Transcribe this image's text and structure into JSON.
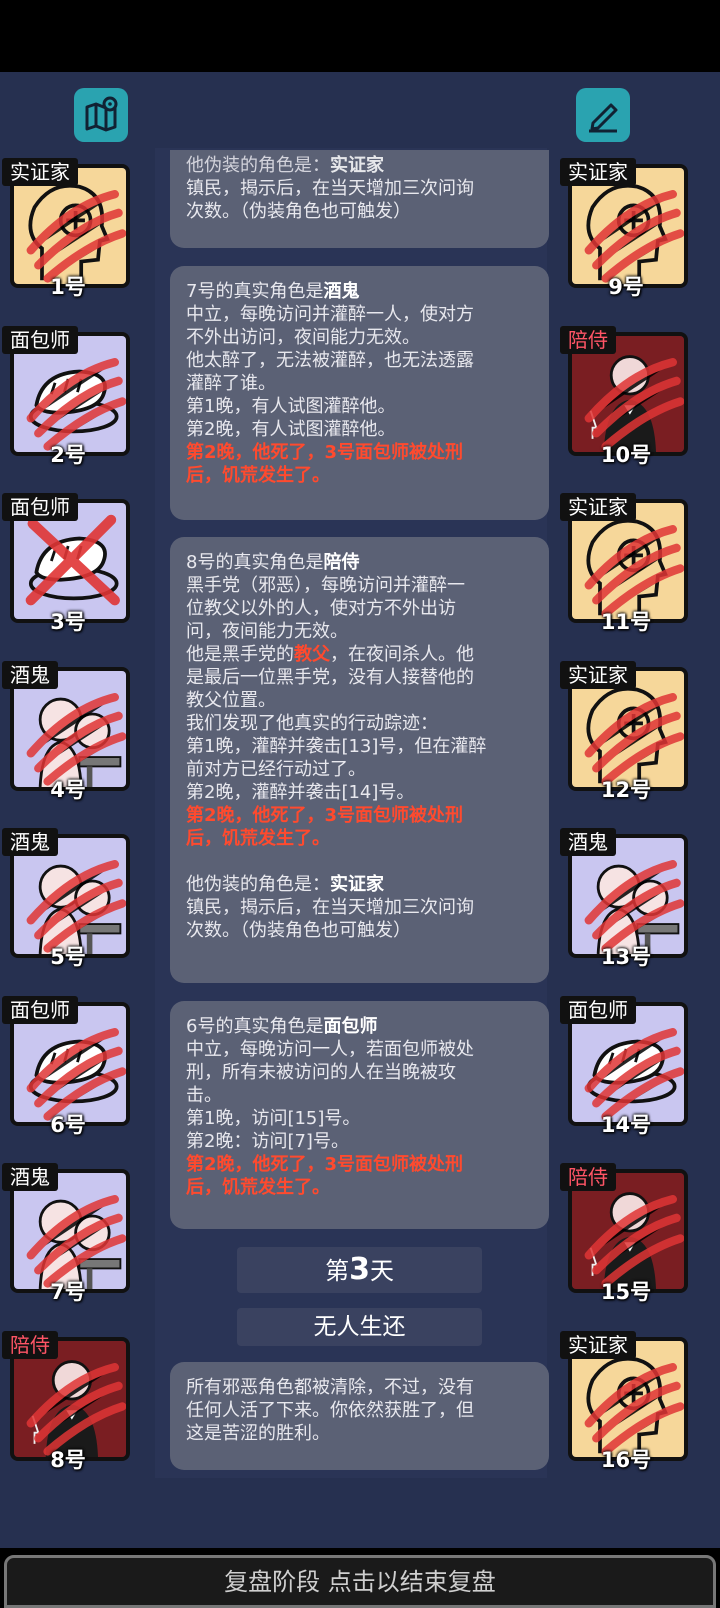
{
  "header": {
    "map_icon": "map-icon",
    "notes_icon": "pen-icon"
  },
  "left_players": [
    {
      "role": "实证家",
      "num": "1号",
      "kind": "empiricist"
    },
    {
      "role": "面包师",
      "num": "2号",
      "kind": "baker"
    },
    {
      "role": "面包师",
      "num": "3号",
      "kind": "baker-x"
    },
    {
      "role": "酒鬼",
      "num": "4号",
      "kind": "drunk"
    },
    {
      "role": "酒鬼",
      "num": "5号",
      "kind": "drunk"
    },
    {
      "role": "面包师",
      "num": "6号",
      "kind": "baker"
    },
    {
      "role": "酒鬼",
      "num": "7号",
      "kind": "drunk"
    },
    {
      "role": "陪侍",
      "num": "8号",
      "kind": "escort"
    }
  ],
  "right_players": [
    {
      "role": "实证家",
      "num": "9号",
      "kind": "empiricist"
    },
    {
      "role": "陪侍",
      "num": "10号",
      "kind": "escort"
    },
    {
      "role": "实证家",
      "num": "11号",
      "kind": "empiricist"
    },
    {
      "role": "实证家",
      "num": "12号",
      "kind": "empiricist"
    },
    {
      "role": "酒鬼",
      "num": "13号",
      "kind": "drunk"
    },
    {
      "role": "面包师",
      "num": "14号",
      "kind": "baker"
    },
    {
      "role": "陪侍",
      "num": "15号",
      "kind": "escort"
    },
    {
      "role": "实证家",
      "num": "16号",
      "kind": "empiricist"
    }
  ],
  "log": {
    "m0": {
      "line1_a": "他伪装的角色是：",
      "line1_b": "实证家",
      "line2": "镇民，揭示后，在当天增加三次问询",
      "line3": "次数。（伪装角色也可触发）"
    },
    "m1": {
      "title_a": "7号的真实角色是",
      "title_b": "酒鬼",
      "l1": "中立，每晚访问并灌醉一人，使对方",
      "l2": "不外出访问，夜间能力无效。",
      "l3": "他太醉了，无法被灌醉，也无法透露",
      "l4": "灌醉了谁。",
      "l5": "第1晚，有人试图灌醉他。",
      "l6": "第2晚，有人试图灌醉他。",
      "r1": "第2晚，他死了，3号面包师被处刑",
      "r2": "后，饥荒发生了。"
    },
    "m2": {
      "title_a": "8号的真实角色是",
      "title_b": "陪侍",
      "l1": "黑手党（邪恶），每晚访问并灌醉一",
      "l2": "位教父以外的人，使对方不外出访",
      "l3": "问，夜间能力无效。",
      "l4a": "他是黑手党的",
      "l4b": "教父",
      "l4c": "，在夜间杀人。他",
      "l5": "是最后一位黑手党，没有人接替他的",
      "l6": "教父位置。",
      "l7": "我们发现了他真实的行动踪迹：",
      "l8": "第1晚，灌醉并袭击[13]号，但在灌醉",
      "l9": "前对方已经行动过了。",
      "l10": "第2晚，灌醉并袭击[14]号。",
      "r1": "第2晚，他死了，3号面包师被处刑",
      "r2": "后，饥荒发生了。",
      "d1a": "他伪装的角色是：",
      "d1b": "实证家",
      "d2": "镇民，揭示后，在当天增加三次问询",
      "d3": "次数。（伪装角色也可触发）"
    },
    "m3": {
      "title_a": "6号的真实角色是",
      "title_b": "面包师",
      "l1": "中立，每晚访问一人，若面包师被处",
      "l2": "刑，所有未被访问的人在当晚被攻",
      "l3": "击。",
      "l4": "第1晚，访问[15]号。",
      "l5": "第2晚：访问[7]号。",
      "r1": "第2晚，他死了，3号面包师被处刑",
      "r2": "后，饥荒发生了。"
    },
    "day": {
      "pre": "第",
      "n": "3",
      "post": "天"
    },
    "outcome": "无人生还",
    "m4": {
      "l1": "所有邪恶角色都被清除，不过，没有",
      "l2": "任何人活了下来。你依然获胜了，但",
      "l3": "这是苦涩的胜利。"
    }
  },
  "footer": {
    "label": "复盘阶段 点击以结束复盘"
  },
  "colors": {
    "bg": "#263050",
    "empiricist": "#f6d79a",
    "baker": "#c9c6f0",
    "escort": "#7a1e22",
    "slash": "#e03535",
    "alert": "#ff4a2e"
  }
}
